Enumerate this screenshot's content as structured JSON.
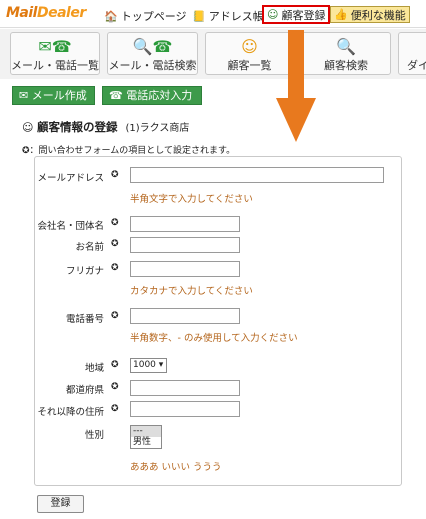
{
  "app": {
    "logo_mail": "Mail",
    "logo_dealer": "Dealer"
  },
  "nav": {
    "home": {
      "icon": "home-icon",
      "label": "トップページ"
    },
    "address": {
      "icon": "book-icon",
      "label": "アドレス帳"
    },
    "customer": {
      "icon": "smile-icon",
      "label": "顧客登録"
    },
    "tools": {
      "icon": "thumbs-up-icon",
      "label": "便利な機能"
    }
  },
  "toolbar": {
    "mail_phone_list": "メール・電話一覧",
    "mail_phone_search": "メール・電話検索",
    "customer_list": "顧客一覧",
    "customer_search": "顧客検索",
    "cut_off": "ダイ"
  },
  "actions": {
    "compose_mail": "メール作成",
    "phone_record": "電話応対入力"
  },
  "form": {
    "title": "顧客情報の登録",
    "subtitle": "(1)ラクス商店",
    "required_note": "：問い合わせフォームの項目として設定されます。",
    "fields": {
      "email": {
        "label": "メールアドレス",
        "hint": "半角文字で入力してください"
      },
      "company": {
        "label": "会社名・団体名"
      },
      "name": {
        "label": "お名前"
      },
      "furigana": {
        "label": "フリガナ",
        "hint": "カタカナで入力してください"
      },
      "phone": {
        "label": "電話番号",
        "hint": "半角数字、- のみ使用して入力ください"
      },
      "region": {
        "label": "地域",
        "value": "1000"
      },
      "prefecture": {
        "label": "都道府県"
      },
      "address": {
        "label": "それ以降の住所"
      },
      "gender": {
        "label": "性別",
        "options": [
          "---",
          "男性"
        ],
        "hint": "あああ いいい ううう"
      }
    },
    "submit": "登録"
  },
  "colors": {
    "accent_orange": "#e8791e",
    "green": "#3d9a4a",
    "hint": "#b4651c",
    "highlight_border": "#dd0000"
  }
}
